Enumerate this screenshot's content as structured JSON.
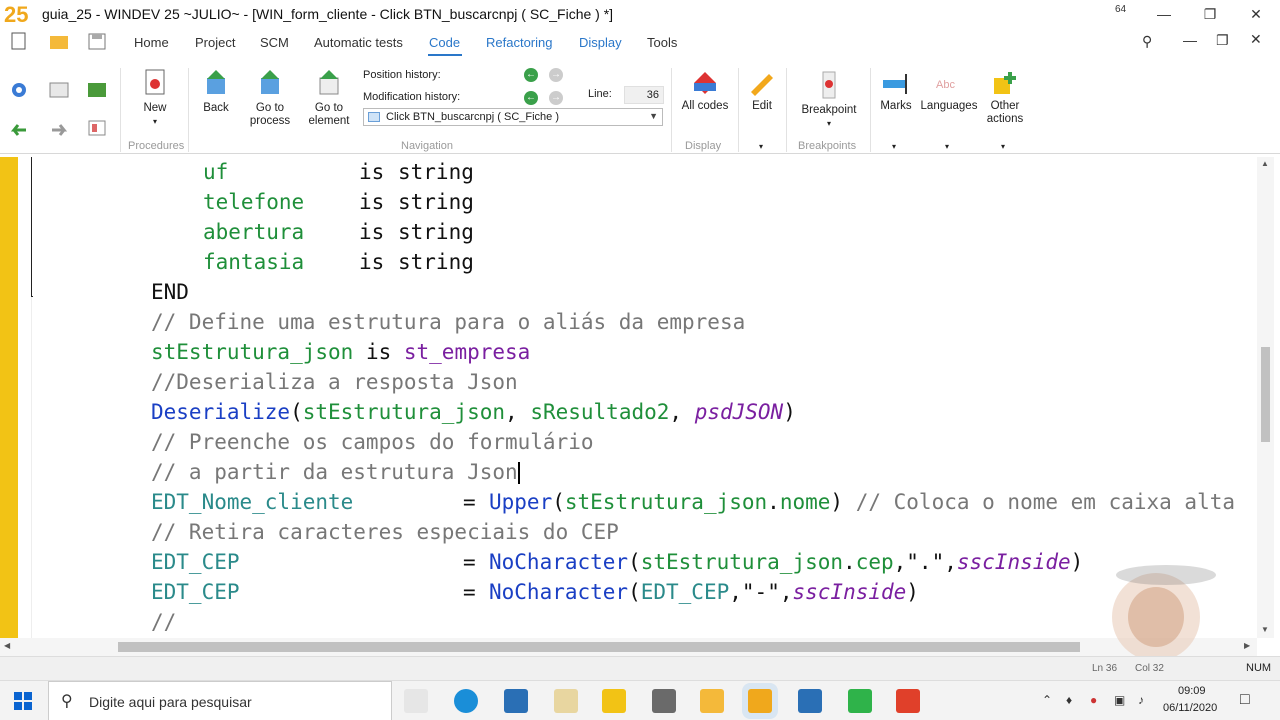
{
  "window": {
    "title": "guia_25 - WINDEV 25 ~JULIO~ - [WIN_form_cliente - Click BTN_buscarcnpj ( SC_Fiche ) *]",
    "badge": "64"
  },
  "menu": {
    "tabs": [
      "Home",
      "Project",
      "SCM",
      "Automatic tests",
      "Code",
      "Refactoring",
      "Display",
      "Tools"
    ],
    "active": "Code"
  },
  "ribbon": {
    "new_label": "New",
    "back_label": "Back",
    "goto_process_label": "Go to process",
    "goto_process_l1": "Go to",
    "goto_process_l2": "process",
    "goto_element_l1": "Go to",
    "goto_element_l2": "element",
    "position_history_label": "Position history:",
    "modification_history_label": "Modification history:",
    "line_label": "Line:",
    "line_value": "36",
    "navigation_select": "Click BTN_buscarcnpj ( SC_Fiche )",
    "all_codes_label": "All codes",
    "edit_label": "Edit",
    "breakpoint_label": "Breakpoint",
    "marks_label": "Marks",
    "languages_label": "Languages",
    "other_actions_l1": "Other",
    "other_actions_l2": "actions",
    "groups": {
      "procedures": "Procedures",
      "navigation": "Navigation",
      "display": "Display",
      "breakpoints": "Breakpoints"
    }
  },
  "code": {
    "l1_var": "uf",
    "l1_is": "is",
    "l1_type": "string",
    "l2_var": "telefone",
    "l2_is": "is",
    "l2_type": "string",
    "l3_var": "abertura",
    "l3_is": "is",
    "l3_type": "string",
    "l4_var": "fantasia",
    "l4_is": "is",
    "l4_type": "string",
    "l5": "END",
    "l6": "// Define uma estrutura para o aliás da empresa",
    "l7_var": "stEstrutura_json",
    "l7_is": " is ",
    "l7_type": "st_empresa",
    "l8": "//Deserializa a resposta Json",
    "l9_fn": "Deserialize",
    "l9_open": "(",
    "l9_a1": "stEstrutura_json",
    "l9_c1": ", ",
    "l9_a2": "sResultado2",
    "l9_c2": ", ",
    "l9_a3": "psdJSON",
    "l9_close": ")",
    "l10": "// Preenche os campos do formulário",
    "l11": "// a partir da estrutura Json",
    "l12_ctrl": "EDT_Nome_cliente",
    "l12_eq": "= ",
    "l12_fn": "Upper",
    "l12_open": "(",
    "l12_arg": "stEstrutura_json",
    "l12_dot": ".",
    "l12_field": "nome",
    "l12_close": ")",
    "l12_cm": " // Coloca o nome em caixa alta",
    "l13": "// Retira caracteres especiais do CEP",
    "l14_ctrl": "EDT_CEP",
    "l14_eq": "= ",
    "l14_fn": "NoCharacter",
    "l14_open": "(",
    "l14_arg": "stEstrutura_json",
    "l14_dot": ".",
    "l14_field": "cep",
    "l14_sep1": ",",
    "l14_str": "\".\"",
    "l14_sep2": ",",
    "l14_const": "sscInside",
    "l14_close": ")",
    "l15_ctrl": "EDT_CEP",
    "l15_eq": "= ",
    "l15_fn": "NoCharacter",
    "l15_open": "(",
    "l15_arg": "EDT_CEP",
    "l15_sep1": ",",
    "l15_str": "\"-\"",
    "l15_sep2": ",",
    "l15_const": "sscInside",
    "l15_close": ")",
    "l16": "//"
  },
  "status": {
    "line": "Ln 36",
    "col": "Col 32",
    "num": "NUM"
  },
  "taskbar": {
    "search_placeholder": "Digite aqui para pesquisar",
    "time": "09:09",
    "date": "06/11/2020"
  },
  "colors": {
    "accent": "#2a77c9",
    "gutter": "#f2c315",
    "comment": "#777777",
    "variable": "#1f8f3a",
    "type": "#7a1fa0",
    "function": "#1a3fc4"
  }
}
